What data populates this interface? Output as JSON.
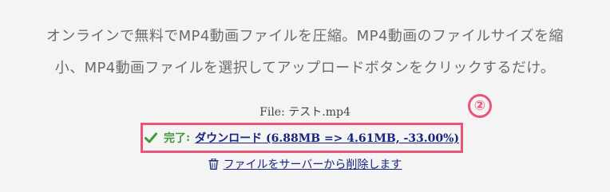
{
  "intro": {
    "line1": "オンラインで無料でMP4動画ファイルを圧縮。MP4動画のファイルサイズを縮",
    "line2": "小、MP4動画ファイルを選択してアップロードボタンをクリックするだけ。"
  },
  "file": {
    "label": "File: テスト.mp4"
  },
  "annotation": {
    "marker": "②",
    "color": "#e8547a"
  },
  "result": {
    "status": "完了",
    "status_colon": ":",
    "status_color": "#3f9b3f",
    "download_label": "ダウンロード",
    "download_detail": " (6.88MB => 4.61MB, -33.00%)",
    "link_color": "#1a237e",
    "icon": "check-icon"
  },
  "delete": {
    "label": "ファイルをサーバーから削除します",
    "icon": "trash-icon"
  }
}
